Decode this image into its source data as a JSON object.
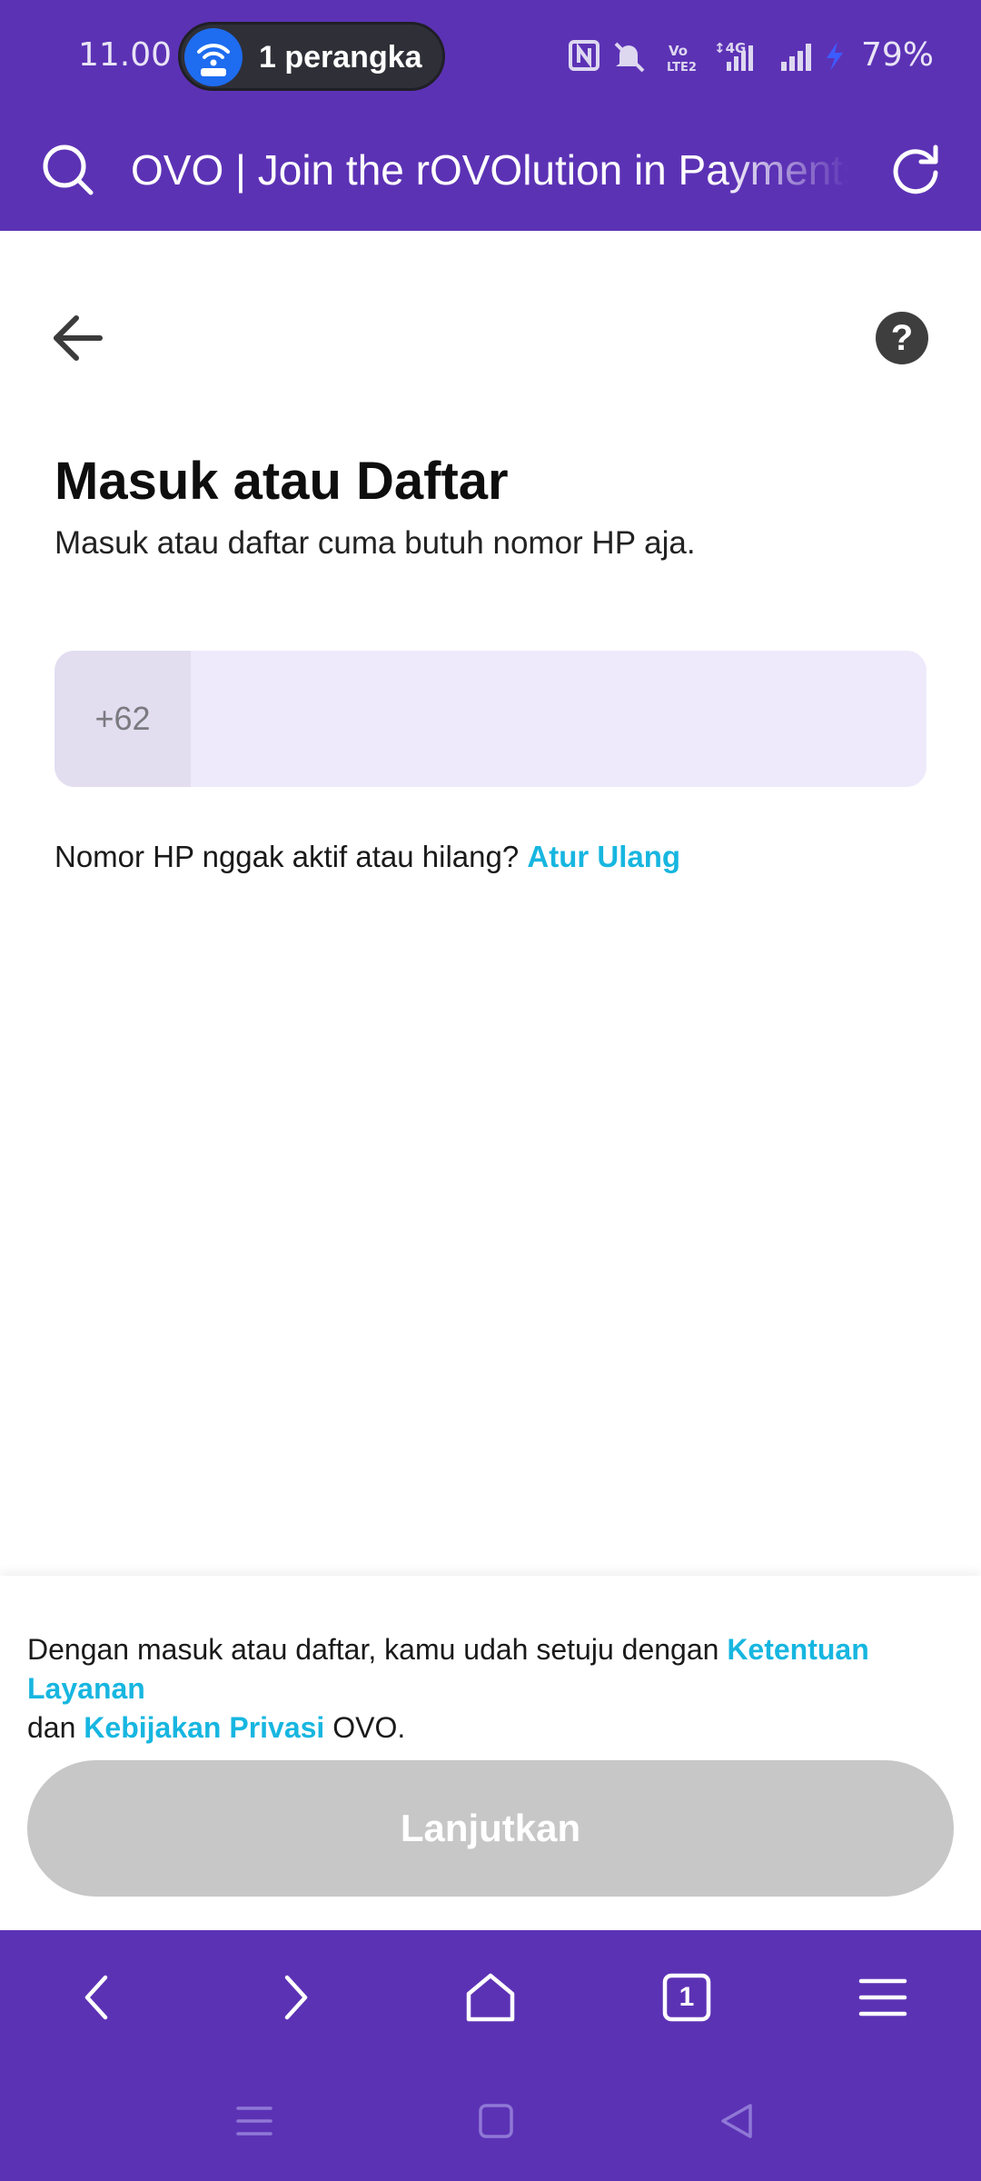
{
  "status_bar": {
    "time": "11.00",
    "hotspot_label": "1 perangka",
    "battery": "79%",
    "icons": [
      "nfc-icon",
      "mute-icon",
      "volte-icon",
      "4g-signal-icon",
      "signal-icon",
      "charging-icon"
    ]
  },
  "url_bar": {
    "page_title": "OVO | Join the rOVOlution in Payments"
  },
  "page": {
    "title": "Masuk atau Daftar",
    "subtitle": "Masuk atau daftar cuma butuh nomor HP aja.",
    "help_label": "?",
    "phone_prefix": "+62",
    "phone_value": "",
    "reset_text": "Nomor HP nggak aktif atau hilang?",
    "reset_link": "Atur Ulang"
  },
  "footer": {
    "terms_prefix": "Dengan masuk atau daftar, kamu udah setuju dengan",
    "terms_link": "Ketentuan Layanan",
    "terms_and": "dan",
    "privacy_link": "Kebijakan Privasi",
    "terms_suffix": "OVO.",
    "continue_label": "Lanjutkan"
  },
  "browser_nav": {
    "tab_count": "1"
  },
  "colors": {
    "brand": "#5c32b5",
    "link": "#17b6e0",
    "field_bg": "#eeeafb",
    "button_disabled": "#c7c7c7"
  }
}
